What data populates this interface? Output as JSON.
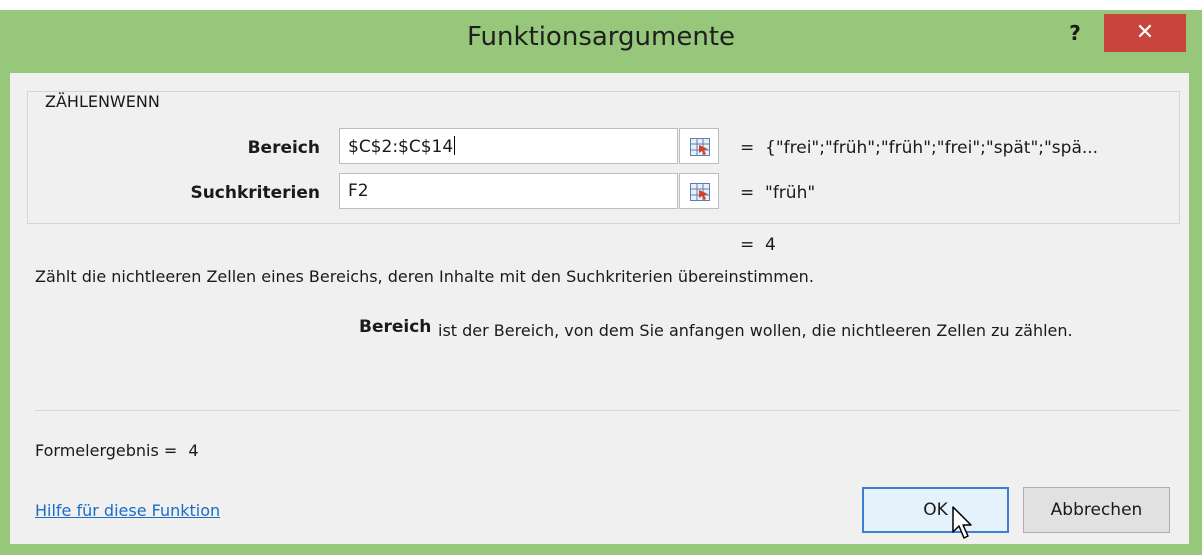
{
  "window": {
    "title": "Funktionsargumente",
    "help_label": "?",
    "close_label": "✕"
  },
  "function": {
    "name": "ZÄHLENWENN",
    "args": [
      {
        "label": "Bereich",
        "value": "$C$2:$C$14",
        "result": "{\"frei\";\"früh\";\"früh\";\"frei\";\"spät\";\"spä..."
      },
      {
        "label": "Suchkriterien",
        "value": "F2",
        "result": "\"früh\""
      }
    ],
    "eq_sign": "=",
    "result_total": "4",
    "description": "Zählt die nichtleeren Zellen eines Bereichs, deren Inhalte mit den Suchkriterien übereinstimmen.",
    "arg_description": {
      "name": "Bereich",
      "text": "ist der Bereich, von dem Sie anfangen wollen, die nichtleeren Zellen zu zählen."
    }
  },
  "footer": {
    "formula_result_label": "Formelergebnis =",
    "formula_result_value": "4",
    "help_link": "Hilfe für diese Funktion",
    "ok_label": "OK",
    "cancel_label": "Abbrechen"
  },
  "colors": {
    "frame": "#96c77a",
    "close": "#c8453d",
    "link": "#1a6dc6"
  }
}
